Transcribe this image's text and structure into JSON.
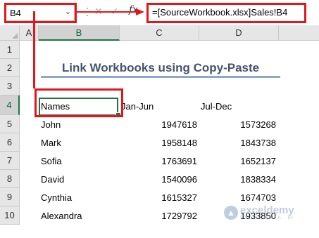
{
  "name_box": {
    "value": "B4",
    "dropdown_icon": "chevron-down-icon"
  },
  "formula_bar": {
    "separator_icon": "vertical-dots-icon",
    "cancel_icon": "cancel-x-icon",
    "enter_icon": "check-icon",
    "fx_label": "fx",
    "formula": "=[SourceWorkbook.xlsx]Sales!B4"
  },
  "columns": [
    "A",
    "B",
    "C",
    "D"
  ],
  "rows": [
    "1",
    "2",
    "3",
    "4",
    "5",
    "6",
    "7",
    "8",
    "9",
    "10"
  ],
  "title": "Link Workbooks using Copy-Paste",
  "headers": {
    "names": "Names",
    "jan_jun": "Jan-Jun",
    "jul_dec": "Jul-Dec"
  },
  "data": [
    {
      "name": "John",
      "jan_jun": "1947618",
      "jul_dec": "1573268"
    },
    {
      "name": "Mark",
      "jan_jun": "1958148",
      "jul_dec": "1843738"
    },
    {
      "name": "Sofia",
      "jan_jun": "1763691",
      "jul_dec": "1652137"
    },
    {
      "name": "David",
      "jan_jun": "1540096",
      "jul_dec": "1838334"
    },
    {
      "name": "Cynthia",
      "jan_jun": "1615327",
      "jul_dec": "1674703"
    },
    {
      "name": "Alexandra",
      "jan_jun": "1729792",
      "jul_dec": "1933850"
    }
  ],
  "watermark": {
    "name": "exceldemy",
    "tagline": "EXCEL · DATA · BI"
  },
  "colors": {
    "highlight_red": "#e3161a",
    "excel_green": "#217346",
    "title_blue": "#44546a"
  }
}
